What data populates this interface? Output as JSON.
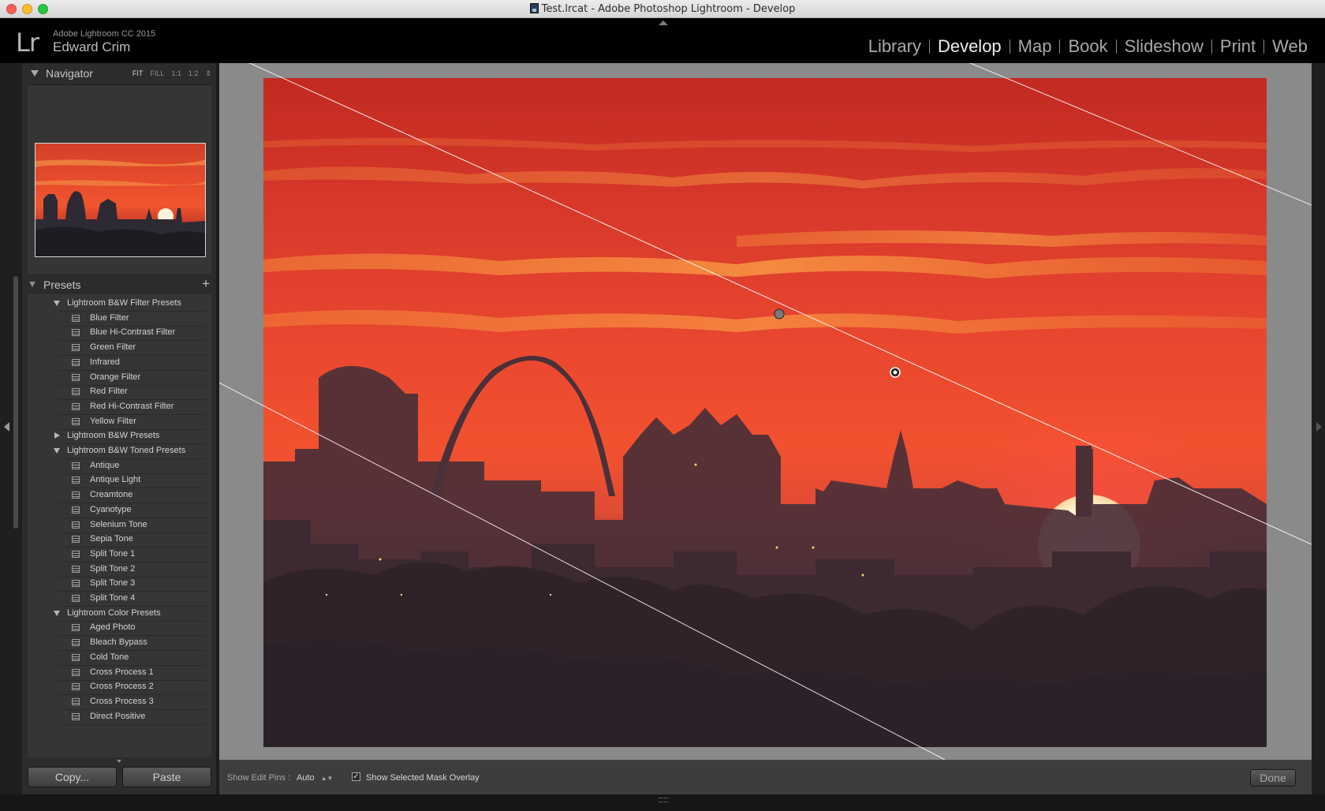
{
  "window": {
    "title": "Test.lrcat - Adobe Photoshop Lightroom - Develop"
  },
  "identity": {
    "logo": "Lr",
    "app_name": "Adobe Lightroom CC 2015",
    "user_name": "Edward Crim"
  },
  "modules": {
    "items": [
      "Library",
      "Develop",
      "Map",
      "Book",
      "Slideshow",
      "Print",
      "Web"
    ],
    "active": "Develop"
  },
  "navigator": {
    "title": "Navigator",
    "zoom_options": [
      "FIT",
      "FILL",
      "1:1",
      "1:2"
    ],
    "active_zoom": "FIT"
  },
  "presets": {
    "title": "Presets",
    "add_icon": "plus-icon",
    "rows": [
      {
        "type": "folder",
        "label": "Lightroom B&W Filter Presets",
        "expanded": true
      },
      {
        "type": "preset",
        "label": "Blue Filter"
      },
      {
        "type": "preset",
        "label": "Blue Hi-Contrast Filter"
      },
      {
        "type": "preset",
        "label": "Green Filter"
      },
      {
        "type": "preset",
        "label": "Infrared"
      },
      {
        "type": "preset",
        "label": "Orange Filter"
      },
      {
        "type": "preset",
        "label": "Red Filter"
      },
      {
        "type": "preset",
        "label": "Red Hi-Contrast Filter"
      },
      {
        "type": "preset",
        "label": "Yellow Filter"
      },
      {
        "type": "folder",
        "label": "Lightroom B&W Presets",
        "expanded": false
      },
      {
        "type": "folder",
        "label": "Lightroom B&W Toned Presets",
        "expanded": true
      },
      {
        "type": "preset",
        "label": "Antique"
      },
      {
        "type": "preset",
        "label": "Antique Light"
      },
      {
        "type": "preset",
        "label": "Creamtone"
      },
      {
        "type": "preset",
        "label": "Cyanotype"
      },
      {
        "type": "preset",
        "label": "Selenium Tone"
      },
      {
        "type": "preset",
        "label": "Sepia Tone"
      },
      {
        "type": "preset",
        "label": "Split Tone 1"
      },
      {
        "type": "preset",
        "label": "Split Tone 2"
      },
      {
        "type": "preset",
        "label": "Split Tone 3"
      },
      {
        "type": "preset",
        "label": "Split Tone 4"
      },
      {
        "type": "folder",
        "label": "Lightroom Color Presets",
        "expanded": true
      },
      {
        "type": "preset",
        "label": "Aged Photo"
      },
      {
        "type": "preset",
        "label": "Bleach Bypass"
      },
      {
        "type": "preset",
        "label": "Cold Tone"
      },
      {
        "type": "preset",
        "label": "Cross Process 1"
      },
      {
        "type": "preset",
        "label": "Cross Process 2"
      },
      {
        "type": "preset",
        "label": "Cross Process 3"
      },
      {
        "type": "preset",
        "label": "Direct Positive"
      }
    ]
  },
  "buttons": {
    "copy": "Copy...",
    "paste": "Paste",
    "done": "Done"
  },
  "toolbar": {
    "show_edit_pins_label": "Show Edit Pins :",
    "show_edit_pins_value": "Auto",
    "mask_overlay_checked": true,
    "mask_overlay_label": "Show Selected Mask Overlay"
  },
  "colors": {
    "accent_sky": "#e9472f",
    "panel_bg": "#2c2c2c",
    "header_bg": "#000000"
  }
}
